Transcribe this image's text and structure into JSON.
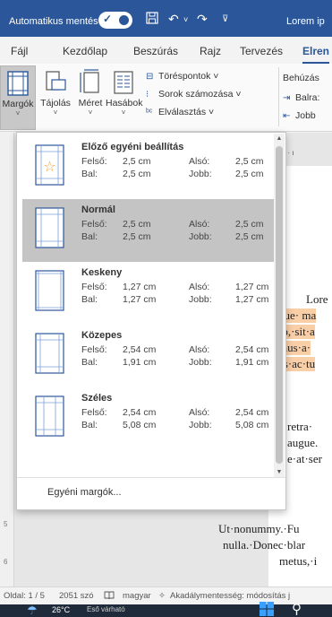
{
  "titlebar": {
    "autosave_label": "Automatikus mentés",
    "doc_title": "Lorem ip"
  },
  "tabs": [
    "Fájl",
    "Kezdőlap",
    "Beszúrás",
    "Rajz",
    "Tervezés",
    "Elren"
  ],
  "ribbon": {
    "margins": "Margók",
    "orientation": "Tájolás",
    "size": "Méret",
    "columns": "Hasábok",
    "breaks": "Töréspontok ˅",
    "line_numbers": "Sorok számozása ˅",
    "hyphenation": "Elválasztás ˅",
    "indent": "Behúzás",
    "indent_left": "Balra:",
    "indent_right": "Jobb"
  },
  "margins_menu": {
    "presets": [
      {
        "name": "Előző egyéni beállítás",
        "top_label": "Felső:",
        "top": "2,5 cm",
        "bottom_label": "Alsó:",
        "bottom": "2,5 cm",
        "left_label": "Bal:",
        "left": "2,5 cm",
        "right_label": "Jobb:",
        "right": "2,5 cm"
      },
      {
        "name": "Normál",
        "top_label": "Felső:",
        "top": "2,5 cm",
        "bottom_label": "Alsó:",
        "bottom": "2,5 cm",
        "left_label": "Bal:",
        "left": "2,5 cm",
        "right_label": "Jobb:",
        "right": "2,5 cm"
      },
      {
        "name": "Keskeny",
        "top_label": "Felső:",
        "top": "1,27 cm",
        "bottom_label": "Alsó:",
        "bottom": "1,27 cm",
        "left_label": "Bal:",
        "left": "1,27 cm",
        "right_label": "Jobb:",
        "right": "1,27 cm"
      },
      {
        "name": "Közepes",
        "top_label": "Felső:",
        "top": "2,54 cm",
        "bottom_label": "Alsó:",
        "bottom": "2,54 cm",
        "left_label": "Bal:",
        "left": "1,91 cm",
        "right_label": "Jobb:",
        "right": "1,91 cm"
      },
      {
        "name": "Széles",
        "top_label": "Felső:",
        "top": "2,54 cm",
        "bottom_label": "Alsó:",
        "bottom": "2,54 cm",
        "left_label": "Bal:",
        "left": "5,08 cm",
        "right_label": "Jobb:",
        "right": "5,08 cm"
      }
    ],
    "custom_label": "Egyéni margók..."
  },
  "document": {
    "lines": [
      "Lore",
      "gue· ma",
      "ro,·sit·a",
      "mus·a·",
      "es·ac·tu",
      "retra·",
      "augue.",
      "e·at·ser",
      "Ut·nonummy.·Fu",
      "nulla.·Donec·blar",
      "metus,·i"
    ],
    "ruler_text": "· 2 · ı"
  },
  "statusbar": {
    "page": "Oldal: 1 / 5",
    "words": "2051 szó",
    "language": "magyar",
    "accessibility": "Akadálymentesség: módosítás j"
  },
  "taskbar": {
    "temperature": "26°C",
    "weather": "Eső várható"
  },
  "colors": {
    "word_blue": "#2b579a",
    "highlight": "#f9cfa8",
    "selected_preset": "#c4c4c4"
  }
}
